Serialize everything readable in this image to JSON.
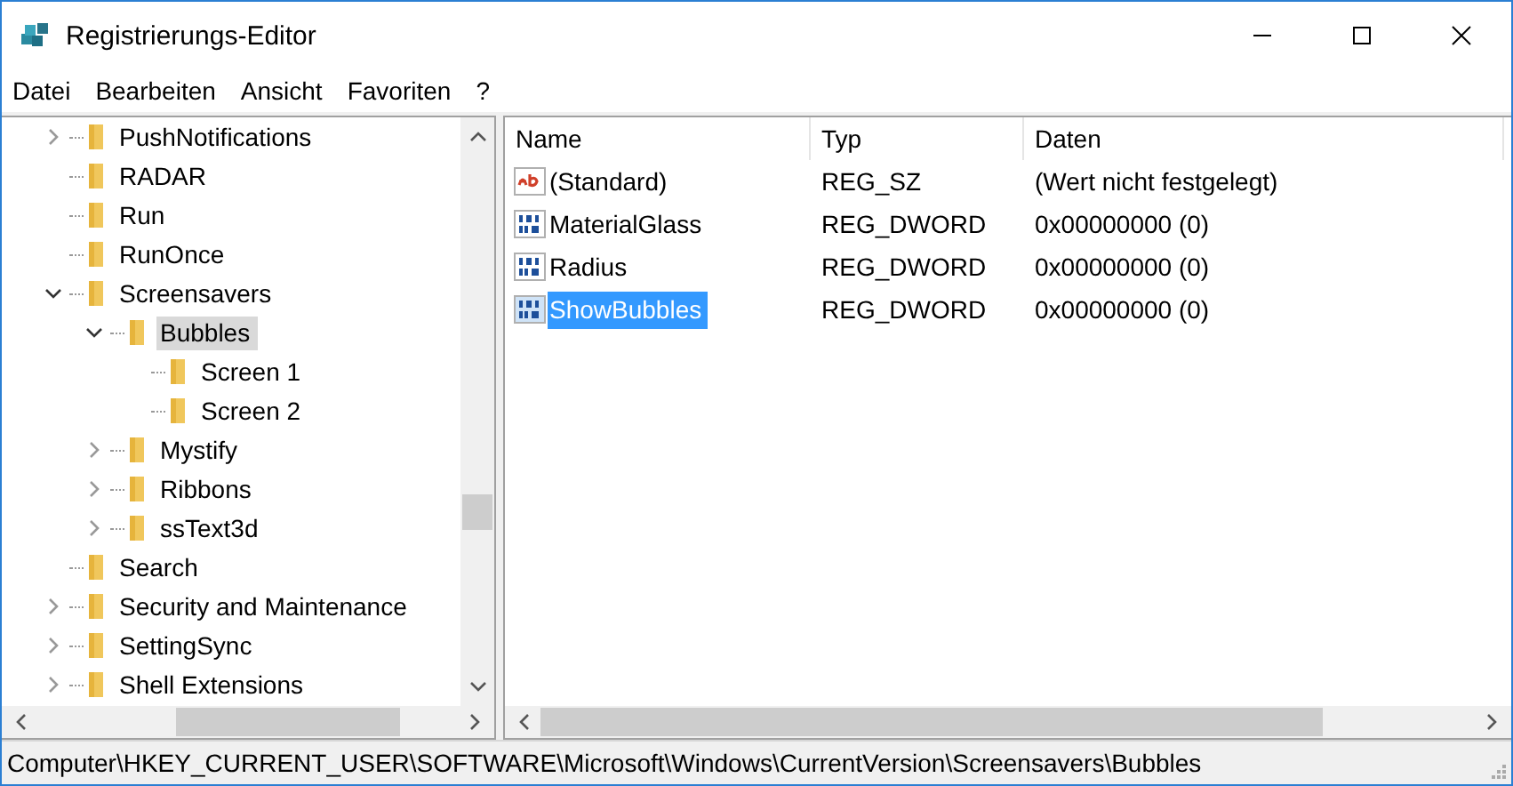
{
  "window": {
    "title": "Registrierungs-Editor"
  },
  "menu": [
    "Datei",
    "Bearbeiten",
    "Ansicht",
    "Favoriten",
    "?"
  ],
  "tree": [
    {
      "label": "PushNotifications",
      "kind": "branch",
      "expanded": false,
      "selected": false
    },
    {
      "label": "RADAR",
      "kind": "leaf",
      "selected": false
    },
    {
      "label": "Run",
      "kind": "leaf",
      "selected": false
    },
    {
      "label": "RunOnce",
      "kind": "leaf",
      "selected": false
    },
    {
      "label": "Screensavers",
      "kind": "branch",
      "expanded": true,
      "selected": false,
      "children": [
        {
          "label": "Bubbles",
          "kind": "branch",
          "expanded": true,
          "selected": true,
          "children": [
            {
              "label": "Screen 1",
              "kind": "leaf",
              "selected": false
            },
            {
              "label": "Screen 2",
              "kind": "leaf",
              "selected": false
            }
          ]
        },
        {
          "label": "Mystify",
          "kind": "branch",
          "expanded": false,
          "selected": false
        },
        {
          "label": "Ribbons",
          "kind": "branch",
          "expanded": false,
          "selected": false
        },
        {
          "label": "ssText3d",
          "kind": "branch",
          "expanded": false,
          "selected": false
        }
      ]
    },
    {
      "label": "Search",
      "kind": "leaf",
      "selected": false
    },
    {
      "label": "Security and Maintenance",
      "kind": "branch",
      "expanded": false,
      "selected": false
    },
    {
      "label": "SettingSync",
      "kind": "branch",
      "expanded": false,
      "selected": false
    },
    {
      "label": "Shell Extensions",
      "kind": "branch",
      "expanded": false,
      "selected": false
    }
  ],
  "table": {
    "columns": [
      "Name",
      "Typ",
      "Daten"
    ],
    "rows": [
      {
        "kind": "string",
        "name": "(Standard)",
        "type": "REG_SZ",
        "data": "(Wert nicht festgelegt)",
        "selected": false
      },
      {
        "kind": "binary",
        "name": "MaterialGlass",
        "type": "REG_DWORD",
        "data": "0x00000000 (0)",
        "selected": false
      },
      {
        "kind": "binary",
        "name": "Radius",
        "type": "REG_DWORD",
        "data": "0x00000000 (0)",
        "selected": false
      },
      {
        "kind": "binary",
        "name": "ShowBubbles",
        "type": "REG_DWORD",
        "data": "0x00000000 (0)",
        "selected": true
      }
    ]
  },
  "status_bar": "Computer\\HKEY_CURRENT_USER\\SOFTWARE\\Microsoft\\Windows\\CurrentVersion\\Screensavers\\Bubbles"
}
